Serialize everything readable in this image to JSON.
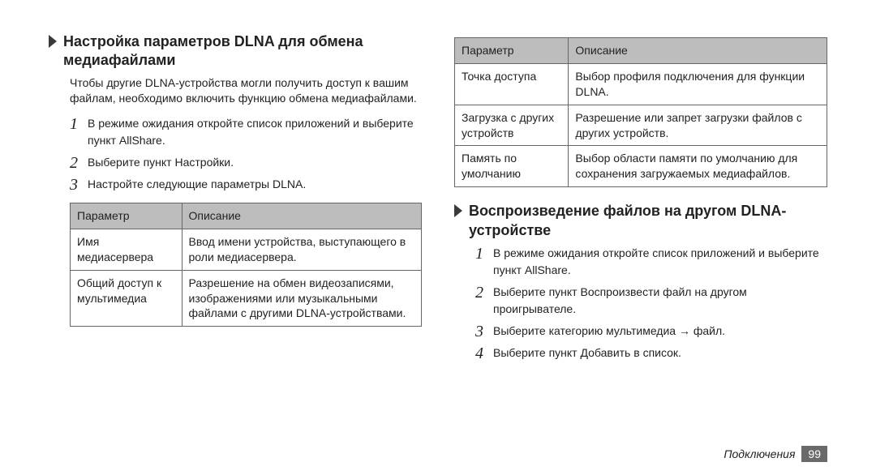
{
  "left": {
    "heading": "Настройка параметров DLNA для обмена медиафайлами",
    "intro": "Чтобы другие DLNA-устройства могли получить доступ к вашим файлам, необходимо включить функцию обмена медиафайлами.",
    "steps": [
      "В режиме ожидания откройте список приложений и выберите пункт AllShare.",
      "Выберите пункт Настройки.",
      "Настройте следующие параметры DLNA."
    ],
    "table": {
      "head": [
        "Параметр",
        "Описание"
      ],
      "rows": [
        [
          "Имя медиасервера",
          "Ввод имени устройства, выступающего в роли медиасервера."
        ],
        [
          "Общий доступ к мультимедиа",
          "Разрешение на обмен видеозаписями, изображениями или музыкальными файлами с другими DLNA-устройствами."
        ]
      ]
    }
  },
  "right": {
    "table": {
      "head": [
        "Параметр",
        "Описание"
      ],
      "rows": [
        [
          "Точка доступа",
          "Выбор профиля подключения для функции DLNA."
        ],
        [
          "Загрузка с других устройств",
          "Разрешение или запрет загрузки файлов с других устройств."
        ],
        [
          "Память по умолчанию",
          "Выбор области памяти по умолчанию для сохранения загружаемых медиафайлов."
        ]
      ]
    },
    "heading": "Воспроизведение файлов на другом DLNA-устройстве",
    "steps": [
      "В режиме ожидания откройте список приложений и выберите пункт AllShare.",
      "Выберите пункт Воспроизвести файл на другом проигрывателе.",
      "Выберите категорию мультимедиа → файл.",
      "Выберите пункт Добавить в список."
    ]
  },
  "footer": {
    "section": "Подключения",
    "page": "99"
  }
}
